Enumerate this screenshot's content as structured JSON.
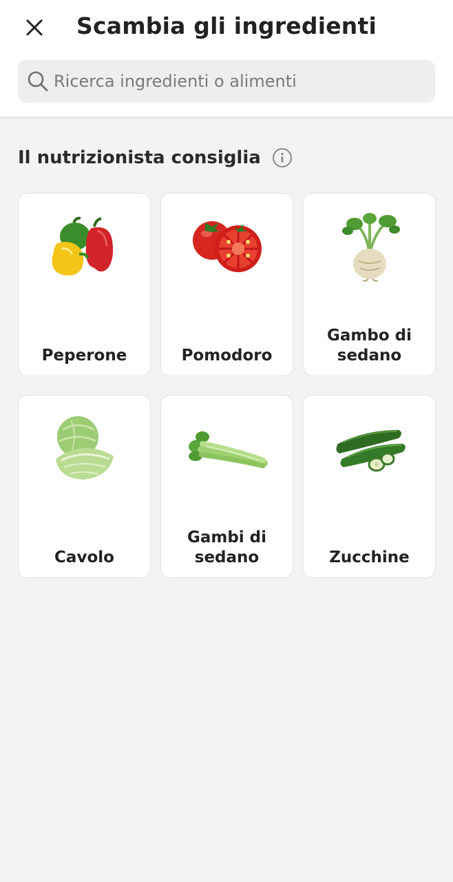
{
  "header": {
    "title": "Scambia gli ingredienti",
    "close_icon": "close-icon"
  },
  "search": {
    "placeholder": "Ricerca ingredienti o alimenti",
    "value": "",
    "icon": "search-icon"
  },
  "section": {
    "title": "Il nutrizionista consiglia",
    "info_icon": "info-icon"
  },
  "ingredients": [
    {
      "label": "Peperone",
      "image": "bell-peppers"
    },
    {
      "label": "Pomodoro",
      "image": "tomatoes"
    },
    {
      "label": "Gambo di sedano",
      "image": "celeriac"
    },
    {
      "label": "Cavolo",
      "image": "cabbage"
    },
    {
      "label": "Gambi di sedano",
      "image": "celery-stalks"
    },
    {
      "label": "Zucchine",
      "image": "zucchini"
    }
  ],
  "colors": {
    "background": "#f3f3f3",
    "card": "#ffffff",
    "search_bg": "#eeeeee",
    "text": "#222222"
  }
}
